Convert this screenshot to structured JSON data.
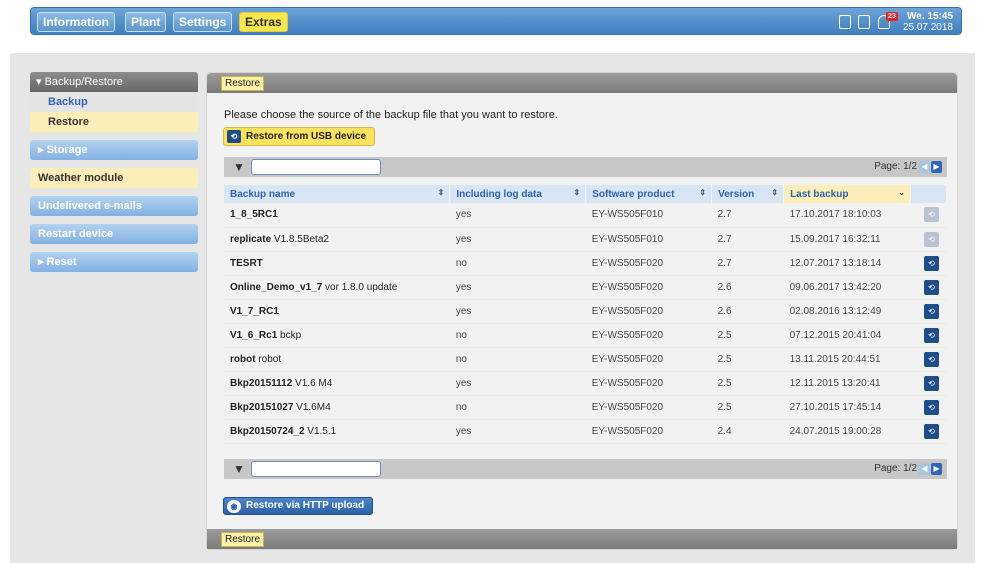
{
  "nav": {
    "information": "Information",
    "plant": "Plant",
    "settings": "Settings",
    "extras": "Extras"
  },
  "topbar": {
    "badge": "23",
    "day_time": "We. 15:45",
    "date": "25.07.2018",
    "icons": [
      "save-icon",
      "clipboard-icon",
      "notification-icon"
    ]
  },
  "sidebar": {
    "section_title": "▾ Backup/Restore",
    "backup": "Backup",
    "restore": "Restore",
    "storage": "▸ Storage",
    "weather": "Weather module",
    "undelivered": "Undelivered e-mails",
    "restart": "Restart device",
    "reset": "▸ Reset"
  },
  "panel": {
    "header_tag": "Restore",
    "footer_tag": "Restore",
    "intro": "Please choose the source of the backup file that you want to restore.",
    "usb_button": "Restore from USB device",
    "http_button": "Restore via HTTP upload",
    "page_label": "Page: 1/2",
    "filter_value": ""
  },
  "table": {
    "columns": {
      "name": "Backup name",
      "log": "Including log data",
      "product": "Software product",
      "version": "Version",
      "last": "Last backup"
    },
    "rows": [
      {
        "name": "1_8_5RC1",
        "suffix": "",
        "log": "yes",
        "product": "EY-WS505F010",
        "version": "2.7",
        "last": "17.10.2017 18:10:03",
        "enabled": false
      },
      {
        "name": "replicate",
        "suffix": " V1.8.5Beta2",
        "log": "yes",
        "product": "EY-WS505F010",
        "version": "2.7",
        "last": "15.09.2017 16:32:11",
        "enabled": false
      },
      {
        "name": "TESRT",
        "suffix": "",
        "log": "no",
        "product": "EY-WS505F020",
        "version": "2.7",
        "last": "12.07.2017 13:18:14",
        "enabled": true
      },
      {
        "name": "Online_Demo_v1_7",
        "suffix": " vor 1.8.0 update",
        "log": "yes",
        "product": "EY-WS505F020",
        "version": "2.6",
        "last": "09.06.2017 13:42:20",
        "enabled": true
      },
      {
        "name": "V1_7_RC1",
        "suffix": "",
        "log": "yes",
        "product": "EY-WS505F020",
        "version": "2.6",
        "last": "02.08.2016 13:12:49",
        "enabled": true
      },
      {
        "name": "V1_6_Rc1",
        "suffix": " bckp",
        "log": "no",
        "product": "EY-WS505F020",
        "version": "2.5",
        "last": "07.12.2015 20:41:04",
        "enabled": true
      },
      {
        "name": "robot",
        "suffix": " robot",
        "log": "no",
        "product": "EY-WS505F020",
        "version": "2.5",
        "last": "13.11.2015 20:44:51",
        "enabled": true
      },
      {
        "name": "Bkp20151112",
        "suffix": " V1.6 M4",
        "log": "yes",
        "product": "EY-WS505F020",
        "version": "2.5",
        "last": "12.11.2015 13:20:41",
        "enabled": true
      },
      {
        "name": "Bkp20151027",
        "suffix": " V1.6M4",
        "log": "no",
        "product": "EY-WS505F020",
        "version": "2.5",
        "last": "27.10.2015 17:45:14",
        "enabled": true
      },
      {
        "name": "Bkp20150724_2",
        "suffix": " V1.5.1",
        "log": "yes",
        "product": "EY-WS505F020",
        "version": "2.4",
        "last": "24.07.2015 19:00:28",
        "enabled": true
      }
    ]
  }
}
